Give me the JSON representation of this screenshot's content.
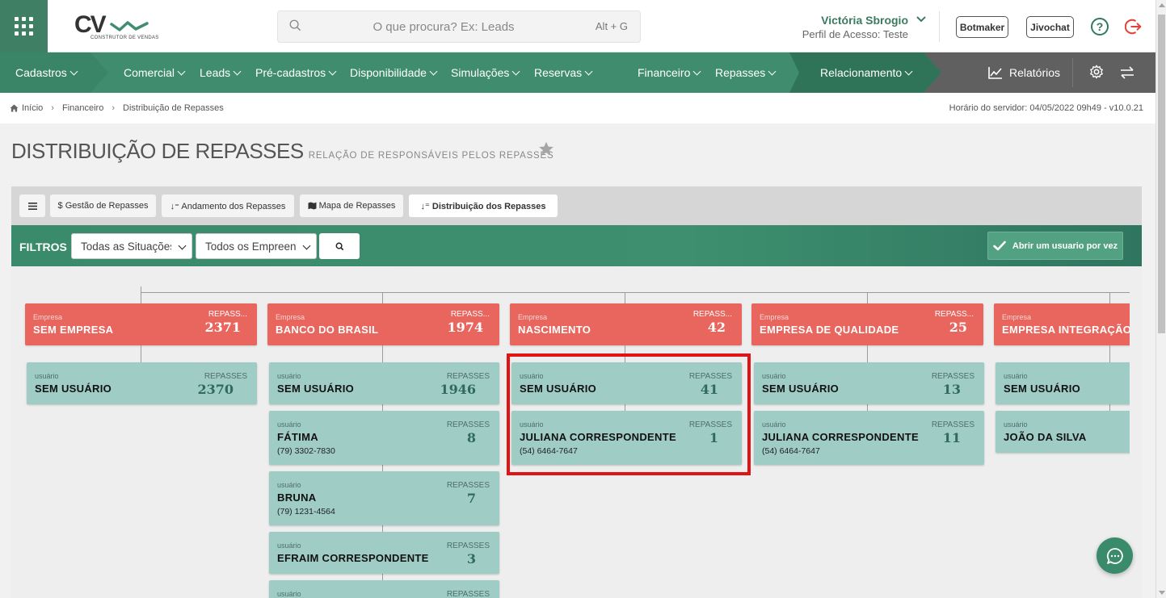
{
  "header": {
    "logo_text": "CV",
    "logo_sub": "CONSTRUTOR DE VENDAS",
    "search_placeholder": "O que procura? Ex: Leads",
    "search_shortcut": "Alt + G",
    "user_name": "Victória Sbrogio",
    "user_profile": "Perfil de Acesso: Teste",
    "botmaker_label": "Botmaker",
    "jivochat_label": "Jivochat",
    "help_label": "?"
  },
  "nav": {
    "items": [
      {
        "label": "Cadastros"
      },
      {
        "label": "Comercial"
      },
      {
        "label": "Leads"
      },
      {
        "label": "Pré-cadastros"
      },
      {
        "label": "Disponibilidade"
      },
      {
        "label": "Simulações"
      },
      {
        "label": "Reservas"
      },
      {
        "label": "Financeiro"
      },
      {
        "label": "Repasses"
      },
      {
        "label": "Relacionamento"
      }
    ],
    "reports_label": "Relatórios"
  },
  "breadcrumb": {
    "items": [
      "Início",
      "Financeiro",
      "Distribuição de Repasses"
    ],
    "server_time": "Horário do servidor: 04/05/2022 09h49 - v10.0.21"
  },
  "page": {
    "title": "DISTRIBUIÇÃO DE REPASSES",
    "subtitle": "RELAÇÃO DE RESPONSÁVEIS PELOS REPASSES"
  },
  "tabs": [
    {
      "icon": "menu-icon",
      "label": "≡"
    },
    {
      "icon": "dollar-icon",
      "label": "$ Gestão de Repasses"
    },
    {
      "icon": "sort-icon",
      "label": "↓⁼ Andamento dos Repasses"
    },
    {
      "icon": "map-icon",
      "label": "Mapa de Repasses"
    },
    {
      "icon": "sort-icon",
      "label": "↓⁼ Distribuição dos Repasses"
    }
  ],
  "filters": {
    "label": "FILTROS",
    "situation_value": "Todas as Situações",
    "enterprise_value": "Todos os Empreendimentos",
    "open_user_label": "Abrir um usuario por vez"
  },
  "tree": {
    "company_label": "Empresa",
    "repasses_label_short": "REPASS...",
    "user_label": "usuário",
    "repasses_label": "REPASSES",
    "columns": [
      {
        "company": "SEM EMPRESA",
        "company_count": "2371",
        "users": [
          {
            "name": "SEM USUÁRIO",
            "count": "2370",
            "phone": ""
          }
        ]
      },
      {
        "company": "BANCO DO BRASIL",
        "company_count": "1974",
        "users": [
          {
            "name": "SEM USUÁRIO",
            "count": "1946",
            "phone": ""
          },
          {
            "name": "FÁTIMA",
            "count": "8",
            "phone": "(79) 3302-7830"
          },
          {
            "name": "BRUNA",
            "count": "7",
            "phone": "(79) 1231-4564"
          },
          {
            "name": "EFRAIM CORRESPONDENTE",
            "count": "3",
            "phone": ""
          },
          {
            "name": "",
            "count": "",
            "phone": ""
          }
        ]
      },
      {
        "company": "NASCIMENTO",
        "company_count": "42",
        "users": [
          {
            "name": "SEM USUÁRIO",
            "count": "41",
            "phone": ""
          },
          {
            "name": "JULIANA CORRESPONDENTE",
            "count": "1",
            "phone": "(54) 6464-7647"
          }
        ]
      },
      {
        "company": "EMPRESA DE QUALIDADE",
        "company_count": "25",
        "users": [
          {
            "name": "SEM USUÁRIO",
            "count": "13",
            "phone": ""
          },
          {
            "name": "JULIANA CORRESPONDENTE",
            "count": "11",
            "phone": "(54) 6464-7647"
          }
        ]
      },
      {
        "company": "EMPRESA INTEGRAÇÃO",
        "company_count": "",
        "users": [
          {
            "name": "SEM USUÁRIO",
            "count": "",
            "phone": ""
          },
          {
            "name": "JOÃO DA SILVA",
            "count": "",
            "phone": ""
          }
        ]
      }
    ]
  },
  "colors": {
    "brand_green": "#3f8d6e",
    "company_card": "#e8665e",
    "user_card": "#9fcdc6",
    "highlight": "#e01414"
  }
}
